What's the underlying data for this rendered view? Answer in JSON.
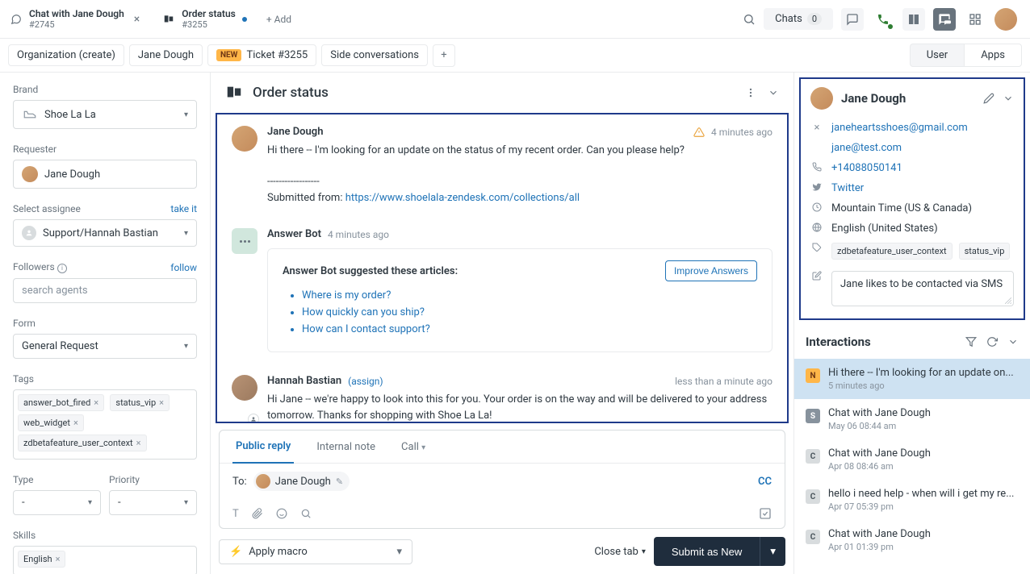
{
  "top_tabs": {
    "tab1": {
      "title": "Chat with Jane Dough",
      "sub": "#2745"
    },
    "tab2": {
      "title": "Order status",
      "sub": "#3255"
    },
    "add": "+ Add"
  },
  "top_right": {
    "chats_label": "Chats",
    "chats_count": "0"
  },
  "context": {
    "org": "Organization (create)",
    "requester": "Jane Dough",
    "ticket_new": "NEW",
    "ticket": "Ticket #3255",
    "side": "Side conversations",
    "user_btn": "User",
    "apps_btn": "Apps"
  },
  "left": {
    "brand_label": "Brand",
    "brand_value": "Shoe La La",
    "requester_label": "Requester",
    "requester_value": "Jane Dough",
    "assignee_label": "Select assignee",
    "takeit": "take it",
    "assignee_value": "Support/Hannah Bastian",
    "followers_label": "Followers",
    "follow": "follow",
    "followers_ph": "search agents",
    "form_label": "Form",
    "form_value": "General Request",
    "tags_label": "Tags",
    "tags": [
      "answer_bot_fired",
      "status_vip",
      "web_widget",
      "zdbetafeature_user_context"
    ],
    "type_label": "Type",
    "type_value": "-",
    "priority_label": "Priority",
    "priority_value": "-",
    "skills_label": "Skills",
    "skills": [
      "English"
    ]
  },
  "ticket": {
    "title": "Order status",
    "msg1": {
      "author": "Jane Dough",
      "time": "4 minutes ago",
      "text": "Hi there -- I'm looking for an update on the status of my recent order. Can you please help?",
      "divider": "------------------",
      "submitted_prefix": "Submitted from: ",
      "submitted_url": "https://www.shoelala-zendesk.com/collections/all"
    },
    "bot": {
      "author": "Answer Bot",
      "time": "4 minutes ago",
      "card_title": "Answer Bot suggested these articles:",
      "improve": "Improve Answers",
      "articles": [
        "Where is my order?",
        "How quickly can you ship?",
        "How can I contact support?"
      ]
    },
    "msg2": {
      "author": "Hannah Bastian",
      "assign": "(assign)",
      "time": "less than a minute ago",
      "text": "Hi Jane -- we're happy to look into this for you. Your order is on the way and will be delivered to your address tomorrow. Thanks for shopping with Shoe La La!"
    }
  },
  "reply": {
    "tab_public": "Public reply",
    "tab_internal": "Internal note",
    "tab_call": "Call",
    "to_label": "To:",
    "to_name": "Jane Dough",
    "cc": "CC"
  },
  "bottom": {
    "macro": "Apply macro",
    "close_tab": "Close tab",
    "submit": "Submit as New"
  },
  "user": {
    "name": "Jane Dough",
    "email1": "janeheartsshoes@gmail.com",
    "email2": "jane@test.com",
    "phone": "+14088050141",
    "twitter": "Twitter",
    "tz": "Mountain Time (US & Canada)",
    "lang": "English (United States)",
    "tags": [
      "zdbetafeature_user_context",
      "status_vip"
    ],
    "note": "Jane likes to be contacted via SMS"
  },
  "interactions": {
    "title": "Interactions",
    "items": [
      {
        "badge": "N",
        "cls": "ib-n",
        "subject": "Hi there -- I'm looking for an update on...",
        "time": "5 minutes ago"
      },
      {
        "badge": "S",
        "cls": "ib-s",
        "subject": "Chat with Jane Dough",
        "time": "May 06 08:44 am"
      },
      {
        "badge": "C",
        "cls": "ib-c",
        "subject": "Chat with Jane Dough",
        "time": "Apr 08 08:46 am"
      },
      {
        "badge": "C",
        "cls": "ib-c",
        "subject": "hello i need help - when will i get my re...",
        "time": "Apr 07 05:39 pm"
      },
      {
        "badge": "C",
        "cls": "ib-c",
        "subject": "Chat with Jane Dough",
        "time": "Apr 01 01:39 pm"
      }
    ]
  }
}
